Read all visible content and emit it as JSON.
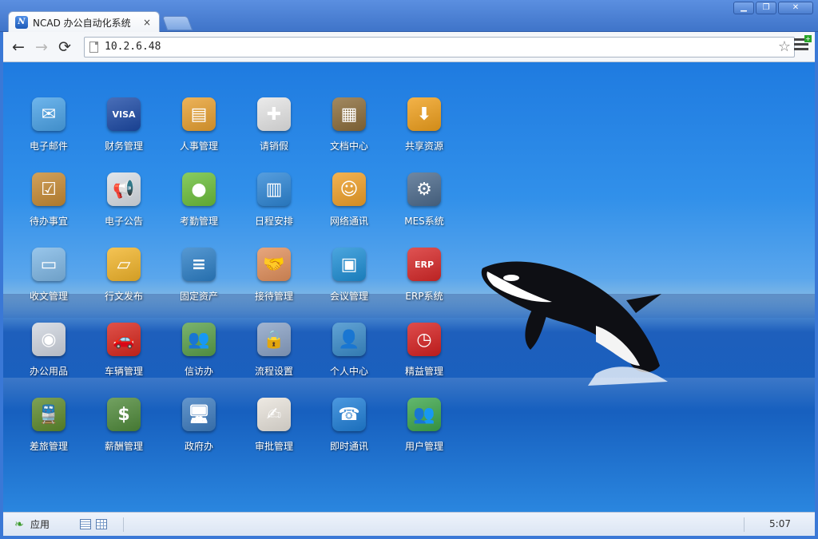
{
  "browser": {
    "tab_title": "NCAD 办公自动化系统",
    "tab_favicon_letter": "N",
    "tab_close": "×",
    "url": "10.2.6.48",
    "window_buttons": [
      "▁",
      "❐",
      "✕"
    ]
  },
  "toolbar": {
    "back": "←",
    "forward": "→",
    "reload": "⟳",
    "star": "☆"
  },
  "apps": [
    {
      "label": "电子邮件",
      "icon": "email-icon",
      "color": "#4aa3e8",
      "glyph": "✉"
    },
    {
      "label": "财务管理",
      "icon": "visa-card-icon",
      "color": "#1c4aa6",
      "glyph": "VISA"
    },
    {
      "label": "人事管理",
      "icon": "folders-icon",
      "color": "#e8a030",
      "glyph": "▤"
    },
    {
      "label": "请销假",
      "icon": "first-aid-kit-icon",
      "color": "#e6e6e6",
      "glyph": "✚"
    },
    {
      "label": "文档中心",
      "icon": "document-box-icon",
      "color": "#8b6c3a",
      "glyph": "▦"
    },
    {
      "label": "共享资源",
      "icon": "shared-gift-icon",
      "color": "#f0a01c",
      "glyph": "⬇"
    },
    {
      "label": "待办事宜",
      "icon": "clipboard-icon",
      "color": "#c68a33",
      "glyph": "☑"
    },
    {
      "label": "电子公告",
      "icon": "megaphone-icon",
      "color": "#d9dfe6",
      "glyph": "📢"
    },
    {
      "label": "考勤管理",
      "icon": "green-button-icon",
      "color": "#6cbf3a",
      "glyph": "●"
    },
    {
      "label": "日程安排",
      "icon": "calendar-pages-icon",
      "color": "#2d86d6",
      "glyph": "▥"
    },
    {
      "label": "网络通讯",
      "icon": "chat-faces-icon",
      "color": "#f0a028",
      "glyph": "☺"
    },
    {
      "label": "MES系统",
      "icon": "mes-tools-icon",
      "color": "#4c6a8c",
      "glyph": "⚙"
    },
    {
      "label": "收文管理",
      "icon": "inbox-tray-icon",
      "color": "#7fb8e6",
      "glyph": "▭"
    },
    {
      "label": "行文发布",
      "icon": "yellow-folder-icon",
      "color": "#f2b52a",
      "glyph": "▱"
    },
    {
      "label": "固定资产",
      "icon": "database-icon",
      "color": "#2c7fc7",
      "glyph": "≡"
    },
    {
      "label": "接待管理",
      "icon": "handshake-icon",
      "color": "#e2905c",
      "glyph": "🤝"
    },
    {
      "label": "会议管理",
      "icon": "notebook-icon",
      "color": "#1e8fd6",
      "glyph": "▣"
    },
    {
      "label": "ERP系统",
      "icon": "oracle-erp-icon",
      "color": "#d72828",
      "glyph": "ERP"
    },
    {
      "label": "办公用品",
      "icon": "software-box-icon",
      "color": "#d0d6e0",
      "glyph": "◉"
    },
    {
      "label": "车辆管理",
      "icon": "red-car-icon",
      "color": "#d8261c",
      "glyph": "🚗"
    },
    {
      "label": "信访办",
      "icon": "people-group-icon",
      "color": "#5aa04a",
      "glyph": "👥"
    },
    {
      "label": "流程设置",
      "icon": "workflow-lock-icon",
      "color": "#8aa2c6",
      "glyph": "🔒"
    },
    {
      "label": "个人中心",
      "icon": "person-icon",
      "color": "#3a8ccb",
      "glyph": "👤"
    },
    {
      "label": "精益管理",
      "icon": "red-clock-icon",
      "color": "#d62020",
      "glyph": "◷"
    },
    {
      "label": "差旅管理",
      "icon": "train-icon",
      "color": "#5d8a2c",
      "glyph": "🚆"
    },
    {
      "label": "薪酬管理",
      "icon": "money-stack-icon",
      "color": "#4f8a3a",
      "glyph": "$"
    },
    {
      "label": "政府办",
      "icon": "computer-screens-icon",
      "color": "#3d7cc0",
      "glyph": "🖥"
    },
    {
      "label": "审批管理",
      "icon": "approval-document-icon",
      "color": "#e9e4dc",
      "glyph": "✍"
    },
    {
      "label": "即时通讯",
      "icon": "phone-bubble-icon",
      "color": "#1f7fd8",
      "glyph": "☎"
    },
    {
      "label": "用户管理",
      "icon": "users-icon",
      "color": "#3ca64a",
      "glyph": "👥"
    }
  ],
  "taskbar": {
    "start_label": "应用",
    "start_icon": "leaf-icon",
    "clock": "5:07"
  }
}
